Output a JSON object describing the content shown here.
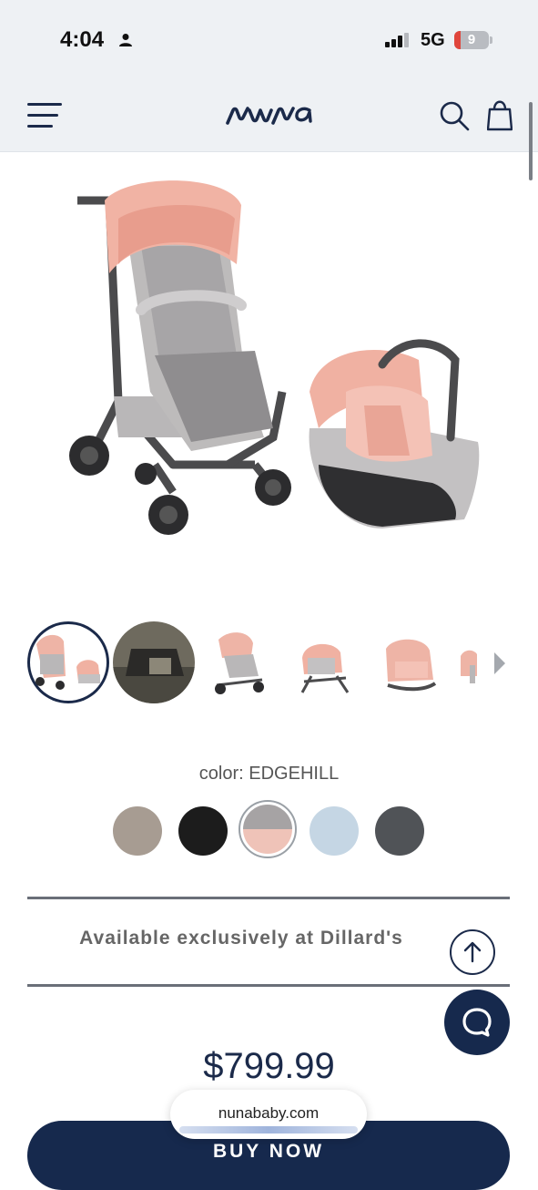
{
  "status_bar": {
    "time": "4:04",
    "network": "5G",
    "battery": "9"
  },
  "header": {
    "brand": "nuna",
    "menu_icon": "hamburger-menu-icon",
    "search_icon": "search-icon",
    "bag_icon": "shopping-bag-icon"
  },
  "product": {
    "color_label": "color: EDGEHILL",
    "swatches": [
      {
        "name": "swatch-taupe",
        "color": "#a79c92"
      },
      {
        "name": "swatch-black",
        "color": "#1c1c1c"
      },
      {
        "name": "swatch-edgehill",
        "color": "#c9a49a"
      },
      {
        "name": "swatch-light-blue",
        "color": "#c5d6e4"
      },
      {
        "name": "swatch-grey",
        "color": "#505357"
      }
    ],
    "availability": "Available exclusively at Dillard's",
    "price": "$799.99",
    "buy_label": "BUY NOW"
  },
  "browser": {
    "url": "nunababy.com"
  },
  "colors": {
    "navy": "#16294d",
    "header_bg": "#eef1f4"
  }
}
